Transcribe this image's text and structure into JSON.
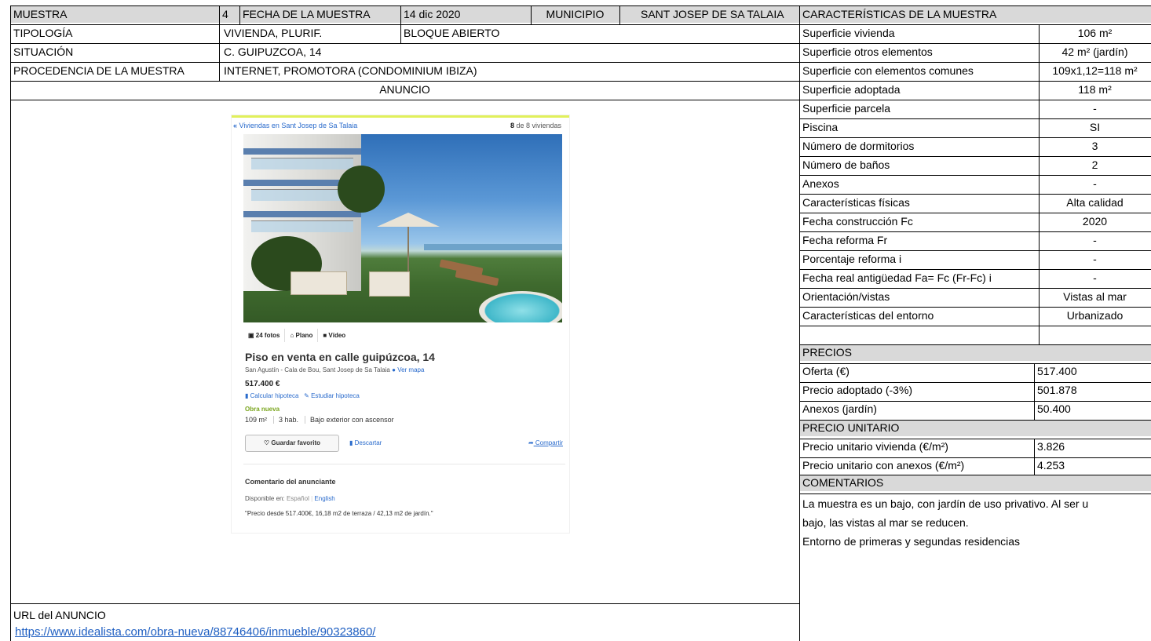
{
  "header": {
    "muestra_label": "MUESTRA",
    "muestra_num": "4",
    "fecha_label": "FECHA DE LA MUESTRA",
    "fecha_value": "14 dic 2020",
    "municipio_label": "MUNICIPIO",
    "municipio_value": "SANT JOSEP DE SA TALAIA",
    "caracteristicas_label": "CARACTERÍSTICAS DE LA MUESTRA"
  },
  "info": {
    "tipologia_label": "TIPOLOGÍA",
    "tipologia_value": "VIVIENDA, PLURIF.",
    "tipologia_extra": "BLOQUE ABIERTO",
    "situacion_label": "SITUACIÓN",
    "situacion_value": "C. GUIPUZCOA, 14",
    "procedencia_label": "PROCEDENCIA DE LA MUESTRA",
    "procedencia_value": "INTERNET, PROMOTORA (CONDOMINIUM IBIZA)",
    "anuncio_label": "ANUNCIO",
    "url_label": "URL del ANUNCIO",
    "url_value": "https://www.idealista.com/obra-nueva/88746406/inmueble/90323860/"
  },
  "characteristics": [
    {
      "label": "Superficie vivienda",
      "value": "106 m²"
    },
    {
      "label": "Superficie otros elementos",
      "value": "42 m² (jardín)"
    },
    {
      "label": "Superficie con elementos comunes",
      "value": "109x1,12=118 m²"
    },
    {
      "label": "Superficie adoptada",
      "value": "118 m²"
    },
    {
      "label": "Superficie parcela",
      "value": "-"
    },
    {
      "label": "Piscina",
      "value": "SI"
    },
    {
      "label": "Número de dormitorios",
      "value": "3"
    },
    {
      "label": "Número de baños",
      "value": "2"
    },
    {
      "label": "Anexos",
      "value": "-"
    },
    {
      "label": "Características físicas",
      "value": "Alta calidad"
    },
    {
      "label": "Fecha construcción Fc",
      "value": "2020"
    },
    {
      "label": "Fecha reforma Fr",
      "value": "-"
    },
    {
      "label": "Porcentaje reforma i",
      "value": "-"
    },
    {
      "label": "Fecha real antigüedad Fa= Fc (Fr-Fc) i",
      "value": "-"
    },
    {
      "label": "Orientación/vistas",
      "value": "Vistas al mar"
    },
    {
      "label": "Características del entorno",
      "value": "Urbanizado"
    }
  ],
  "precios": {
    "title": "PRECIOS",
    "rows": [
      {
        "label": "Oferta (€)",
        "value": "517.400"
      },
      {
        "label": "Precio adoptado (-3%)",
        "value": "501.878"
      },
      {
        "label": "Anexos (jardín)",
        "value": "50.400"
      }
    ]
  },
  "unitario": {
    "title": "PRECIO UNITARIO",
    "rows": [
      {
        "label": "Precio unitario vivienda (€/m²)",
        "value": "3.826"
      },
      {
        "label": "Precio unitario con anexos (€/m²)",
        "value": "4.253"
      }
    ]
  },
  "comentarios": {
    "title": "COMENTARIOS",
    "lines": [
      "La muestra es un bajo, con jardín de uso privativo. Al ser u",
      "bajo, las vistas al mar se reducen.",
      "Entorno de primeras y segundas residencias"
    ]
  },
  "listing": {
    "nav_back": "Viviendas en Sant Josep de Sa Talaia",
    "count_num": "8",
    "count_rest": " de 8 viviendas",
    "tab_fotos": "24 fotos",
    "tab_plano": "Plano",
    "tab_video": "Vídeo",
    "title": "Piso en venta en calle guipúzcoa, 14",
    "location": "San Agustín - Cala de Bou, Sant Josep de Sa Talaia",
    "map_link": "Ver mapa",
    "price": "517.400 €",
    "calc_link": "Calcular hipoteca",
    "study_link": "Estudiar hipoteca",
    "badge": "Obra nueva",
    "detail_area": "109 m²",
    "detail_rooms": "3 hab.",
    "detail_floor": "Bajo exterior con ascensor",
    "fav_button": "Guardar favorito",
    "discard": "Descartar",
    "share": "Compartir",
    "comment_title": "Comentario del anunciante",
    "available_label": "Disponible en:",
    "lang_es": "Español",
    "lang_en": "English",
    "quote": "\"Precio desde 517.400€, 16,18 m2 de terraza / 42,13 m2 de jardín.\""
  }
}
